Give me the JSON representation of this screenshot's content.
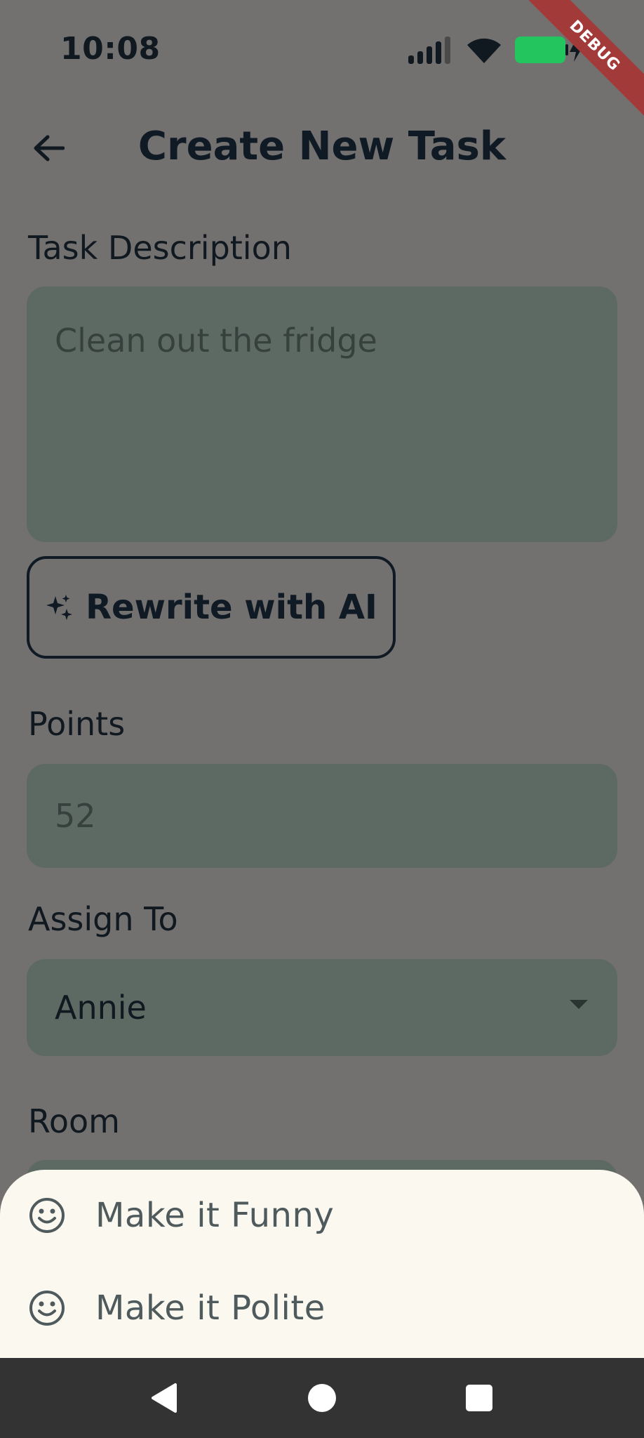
{
  "status": {
    "time": "10:08",
    "debug_label": "DEBUG"
  },
  "appbar": {
    "title": "Create New Task"
  },
  "form": {
    "description_label": "Task Description",
    "description_value": "Clean out the fridge",
    "rewrite_label": "Rewrite with AI",
    "points_label": "Points",
    "points_value": "52",
    "assign_label": "Assign To",
    "assign_value": "Annie",
    "room_label": "Room"
  },
  "sheet": {
    "items": [
      {
        "label": "Make it Funny",
        "icon": "smiley-icon"
      },
      {
        "label": "Make it Polite",
        "icon": "smiley-icon"
      }
    ]
  },
  "colors": {
    "scrim_background": "#737070",
    "field_fill": "#5d6a64",
    "sheet_background": "#fbf8f0",
    "battery": "#22c55e",
    "debug_ribbon": "#a33a3a",
    "navbar": "#333333"
  }
}
